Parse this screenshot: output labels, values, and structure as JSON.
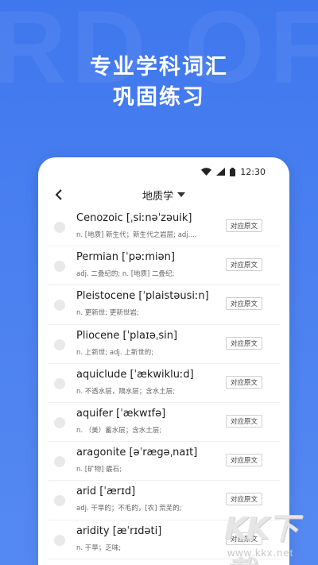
{
  "hero": {
    "line1": "专业学科词汇",
    "line2": "巩固练习",
    "watermark": "RD OF"
  },
  "status_bar": {
    "time": "12:30",
    "icons": [
      "wifi-icon",
      "signal-icon",
      "battery-icon"
    ]
  },
  "nav": {
    "title": "地质学",
    "icons": [
      "back-arrow-icon",
      "caret-down-icon"
    ]
  },
  "words": [
    {
      "term": "Cenozoic [ˌsiːnəˈzəuik]",
      "definition": "n. [地质] 新生代；新生代之岩层; adj....",
      "button": "对应原文"
    },
    {
      "term": "Permian [ˈpəːmiən]",
      "definition": "adj. 二叠纪的; n. [地质] 二叠纪;",
      "button": "对应原文"
    },
    {
      "term": "Pleistocene [ˈplaistəusiːn]",
      "definition": "n. 更新世; 更新世岩;",
      "button": "对应原文"
    },
    {
      "term": "Pliocene [ˈplaɪəˌsin]",
      "definition": "n. 上新世; adj. 上新世的;",
      "button": "对应原文"
    },
    {
      "term": "aquiclude [ˈækwikluːd]",
      "definition": "n. 不透水层，隔水层；含水土层;",
      "button": "对应原文"
    },
    {
      "term": "aquifer [ˈækwɪfə]",
      "definition": "n. （美）蓄水层；含水土层;",
      "button": "对应原文"
    },
    {
      "term": "aragonite [əˈrægəˌnaɪt]",
      "definition": "n. [矿物] 霰石;",
      "button": "对应原文"
    },
    {
      "term": "arid [ˈærɪd]",
      "definition": "adj. 干旱的；不毛的，[农] 荒芜的;",
      "button": "对应原文"
    },
    {
      "term": "aridity [æˈrɪdəti]",
      "definition": "n. 干旱；乏味;",
      "button": "对应原文"
    }
  ],
  "corner_watermark": {
    "text": "KK下载",
    "url": "www.kkx.net"
  },
  "colors": {
    "background_blue": "#4a80f0",
    "card": "#ffffff",
    "radio": "#e9e9e9"
  }
}
